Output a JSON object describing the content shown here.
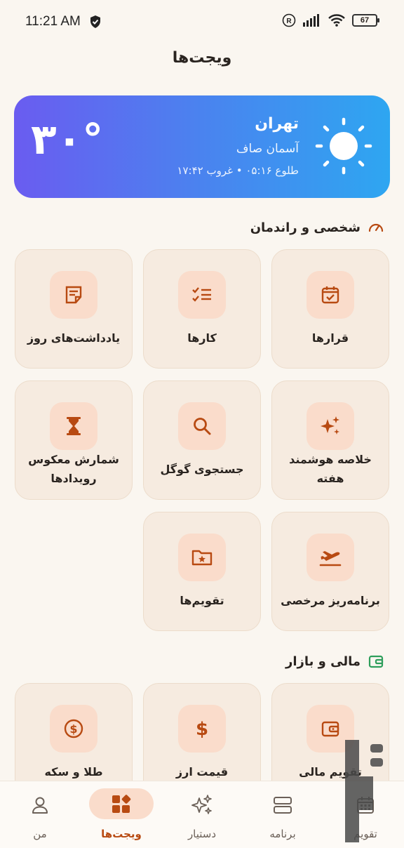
{
  "status": {
    "time": "11:21 AM",
    "battery": "67"
  },
  "page_title": "ویجت‌ها",
  "weather": {
    "temperature": "۳۰°",
    "city": "تهران",
    "condition": "آسمان صاف",
    "sun_times": "طلوع ۰۵:۱۶ • غروب ۱۷:۴۲"
  },
  "sections": {
    "personal": {
      "title": "شخصی و راندمان",
      "tiles": [
        {
          "label": "قرارها",
          "icon": "calendar-check-icon"
        },
        {
          "label": "کارها",
          "icon": "checklist-icon"
        },
        {
          "label": "یادداشت‌های روز",
          "icon": "note-icon"
        },
        {
          "label_1": "خلاصه هوشمند",
          "label_2": "هفته",
          "icon": "sparkles-icon"
        },
        {
          "label": "جستجوی گوگل",
          "icon": "search-icon"
        },
        {
          "label_1": "شمارش معکوس",
          "label_2": "رویدادها",
          "icon": "hourglass-icon"
        },
        {
          "label": "برنامه‌ریز مرخصی",
          "icon": "airplane-takeoff-icon"
        },
        {
          "label": "تقویم‌ها",
          "icon": "folder-star-icon"
        }
      ]
    },
    "finance": {
      "title": "مالی و بازار",
      "tiles": [
        {
          "label": "تقویم مالی",
          "icon": "wallet-icon"
        },
        {
          "label": "قیمت ارز",
          "icon": "dollar-icon"
        },
        {
          "label": "طلا و سکه",
          "icon": "coin-icon"
        }
      ]
    }
  },
  "bottom_nav": [
    {
      "label": "تقویم",
      "icon": "calendar-icon"
    },
    {
      "label": "برنامه",
      "icon": "agenda-icon"
    },
    {
      "label": "دستیار",
      "icon": "sparkles-icon"
    },
    {
      "label": "ویجت‌ها",
      "icon": "widgets-icon",
      "active": true
    },
    {
      "label": "من",
      "icon": "person-icon"
    }
  ],
  "colors": {
    "accent": "#b84a12",
    "tile_bg": "#f6ebe0",
    "icon_bg": "#fadccb",
    "finance_green": "#2e9e5b"
  }
}
